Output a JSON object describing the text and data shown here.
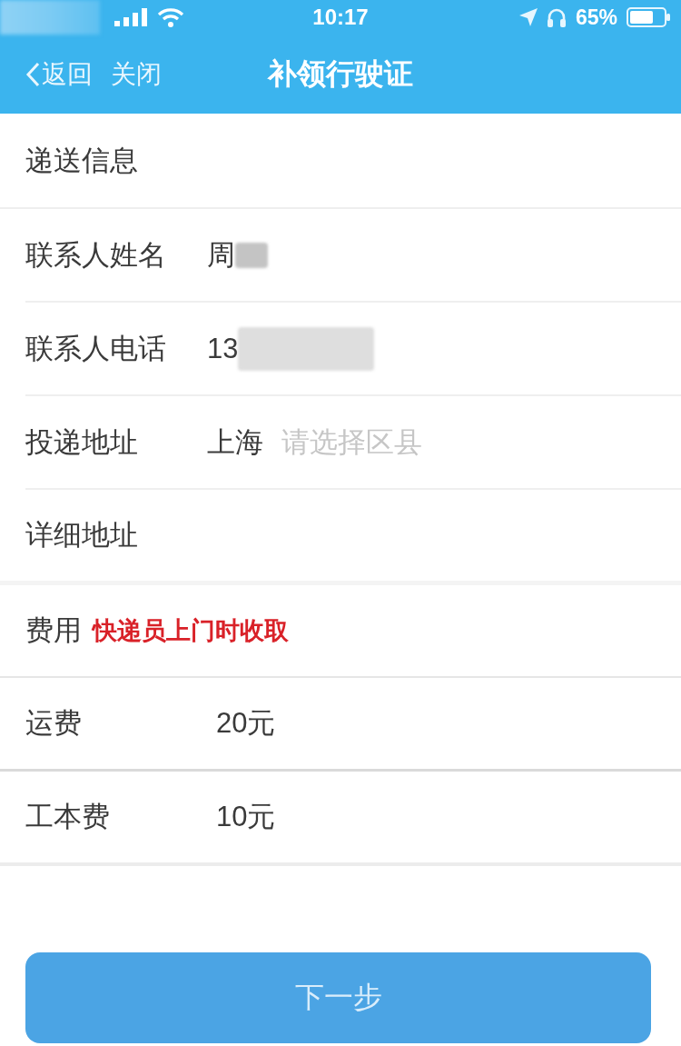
{
  "status_bar": {
    "time": "10:17",
    "battery": "65%"
  },
  "nav": {
    "back": "返回",
    "close": "关闭",
    "title": "补领行驶证"
  },
  "delivery": {
    "title": "递送信息",
    "rows": [
      {
        "label": "联系人姓名",
        "value": "周",
        "redacted": true
      },
      {
        "label": "联系人电话",
        "value": "13",
        "redacted": true
      },
      {
        "label": "投递地址",
        "value": "上海",
        "placeholder": "请选择区县",
        "redacted": false
      },
      {
        "label": "详细地址",
        "redacted": false
      }
    ]
  },
  "fees": {
    "label": "费用",
    "note": "快递员上门时收取",
    "items": [
      {
        "label": "运费",
        "value": "20元"
      },
      {
        "label": "工本费",
        "value": "10元"
      }
    ]
  },
  "next_button": "下一步"
}
